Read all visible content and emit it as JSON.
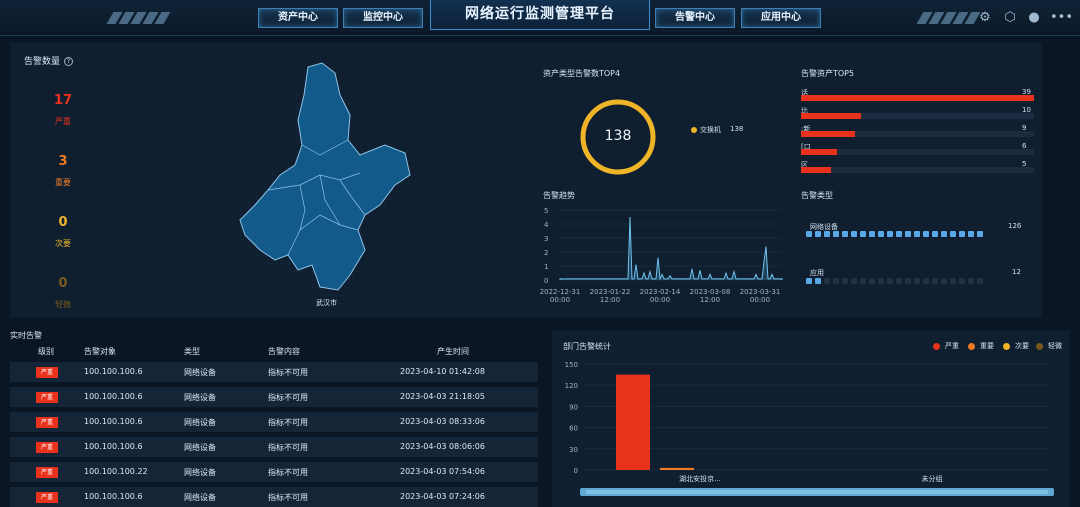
{
  "header": {
    "title": "网络运行监测管理平台",
    "nav_left": [
      "资产中心",
      "监控中心"
    ],
    "nav_right": [
      "告警中心",
      "应用中心"
    ],
    "icons": [
      "gear-icon",
      "cube-icon",
      "user-icon",
      "more-icon"
    ]
  },
  "alarm_count": {
    "title": "告警数量",
    "help": "?",
    "stats": [
      {
        "value": "17",
        "label": "严重",
        "color": "#e8321c"
      },
      {
        "value": "3",
        "label": "重要",
        "color": "#f07a22"
      },
      {
        "value": "0",
        "label": "次要",
        "color": "#f0b429"
      },
      {
        "value": "0",
        "label": "轻微",
        "color": "#7a5a1c"
      }
    ],
    "map_label": "武汉市"
  },
  "asset_type": {
    "title": "资产类型告警数TOP4",
    "total": "138",
    "legend": [
      {
        "name": "交换机",
        "value": "138",
        "color": "#f0b429"
      }
    ]
  },
  "asset_top5": {
    "title": "告警资产TOP5",
    "items": [
      {
        "label": "话",
        "value": 39
      },
      {
        "label": "比",
        "value": 10
      },
      {
        "label": ":新",
        "value": 9
      },
      {
        "label": "[口",
        "value": 6
      },
      {
        "label": "区",
        "value": 5
      }
    ],
    "max": 39
  },
  "alarm_type": {
    "title": "告警类型",
    "items": [
      {
        "label": "网络设备",
        "value": "126",
        "filled": 20
      },
      {
        "label": "应用",
        "value": "12",
        "filled": 2
      }
    ]
  },
  "trend": {
    "title": "告警趋势",
    "yticks": [
      "5",
      "4",
      "3",
      "2",
      "1",
      "0"
    ],
    "xticks": [
      {
        "date": "2022-12-31",
        "time": "00:00"
      },
      {
        "date": "2023-01-22",
        "time": "12:00"
      },
      {
        "date": "2023-02-14",
        "time": "00:00"
      },
      {
        "date": "2023-03-08",
        "time": "12:00"
      },
      {
        "date": "2023-03-31",
        "time": "00:00"
      }
    ]
  },
  "realtime": {
    "title": "实时告警",
    "headers": [
      "级别",
      "告警对象",
      "类型",
      "告警内容",
      "产生时间"
    ],
    "rows": [
      {
        "level": "严重",
        "target": "100.100.100.6",
        "type": "网络设备",
        "content": "指标不可用",
        "time": "2023-04-10 01:42:08"
      },
      {
        "level": "严重",
        "target": "100.100.100.6",
        "type": "网络设备",
        "content": "指标不可用",
        "time": "2023-04-03 21:18:05"
      },
      {
        "level": "严重",
        "target": "100.100.100.6",
        "type": "网络设备",
        "content": "指标不可用",
        "time": "2023-04-03 08:33:06"
      },
      {
        "level": "严重",
        "target": "100.100.100.6",
        "type": "网络设备",
        "content": "指标不可用",
        "time": "2023-04-03 08:06:06"
      },
      {
        "level": "严重",
        "target": "100.100.100.22",
        "type": "网络设备",
        "content": "指标不可用",
        "time": "2023-04-03 07:54:06"
      },
      {
        "level": "严重",
        "target": "100.100.100.6",
        "type": "网络设备",
        "content": "指标不可用",
        "time": "2023-04-03 07:24:06"
      }
    ]
  },
  "chart_data": {
    "type": "bar",
    "title": "部门告警统计",
    "categories": [
      "湖北安投京...",
      "未分组"
    ],
    "series": [
      {
        "name": "严重",
        "color": "#e8321c",
        "values": [
          135,
          0
        ]
      },
      {
        "name": "重要",
        "color": "#f07a22",
        "values": [
          3,
          0
        ]
      },
      {
        "name": "次要",
        "color": "#f0b429",
        "values": [
          0,
          0
        ]
      },
      {
        "name": "轻微",
        "color": "#7a5a1c",
        "values": [
          0,
          0
        ]
      }
    ],
    "yticks": [
      "150",
      "120",
      "90",
      "60",
      "30",
      "0"
    ],
    "ylim": [
      0,
      150
    ],
    "legend_position": "top-right"
  }
}
